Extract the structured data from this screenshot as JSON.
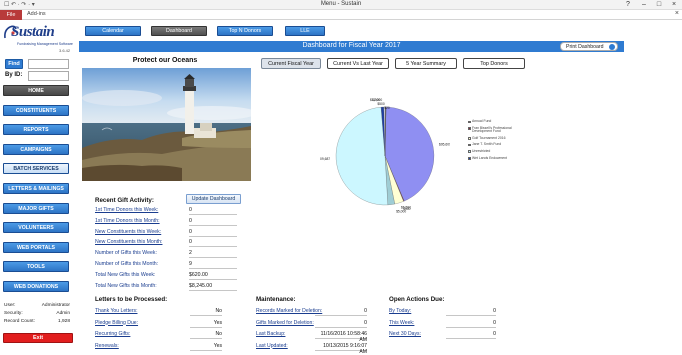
{
  "window": {
    "title": "Menu - Sustain",
    "file_tab": "File",
    "addins_tab": "Add-ins",
    "quick_access": "☐ ↶ · ↷ · ▾"
  },
  "logo": {
    "wordmark": "Sustain",
    "tagline": "Fundraising Management Software",
    "version": "3.6.42"
  },
  "search": {
    "find_label": "Find",
    "by_id_label": "By ID:",
    "find_value": "",
    "id_value": ""
  },
  "nav": [
    {
      "label": "HOME",
      "style": "dark"
    },
    {
      "label": "CONSTITUENTS",
      "style": "blue"
    },
    {
      "label": "REPORTS",
      "style": "blue"
    },
    {
      "label": "CAMPAIGNS",
      "style": "blue"
    },
    {
      "label": "BATCH SERVICES",
      "style": "hover"
    },
    {
      "label": "LETTERS & MAILINGS",
      "style": "blue"
    },
    {
      "label": "MAJOR GIFTS",
      "style": "blue"
    },
    {
      "label": "VOLUNTEERS",
      "style": "blue"
    },
    {
      "label": "WEB PORTALS",
      "style": "blue"
    },
    {
      "label": "TOOLS",
      "style": "blue"
    },
    {
      "label": "WEB DONATIONS",
      "style": "blue"
    }
  ],
  "session": {
    "user_label": "User:",
    "user_value": "Administrator",
    "security_label": "Security:",
    "security_value": "Admin",
    "count_label": "Record Count:",
    "count_value": "1,928"
  },
  "exit_label": "Exit",
  "top_tabs": [
    "Calendar",
    "Dashboard",
    "Top N Donors",
    "LLE"
  ],
  "active_top_tab": "Dashboard",
  "header": {
    "title": "Dashboard for Fiscal Year 2017",
    "print_label": "Print Dashboard"
  },
  "photo": {
    "title": "Protect our Oceans"
  },
  "recent_activity": {
    "title": "Recent Gift Activity:",
    "update_label": "Update Dashboard",
    "rows": [
      {
        "label": "1st Time Donors this Week:",
        "value": "0"
      },
      {
        "label": "1st Time Donors this Month:",
        "value": "0"
      },
      {
        "label": "New Constituents this Week:",
        "value": "0"
      },
      {
        "label": "New Constituents this Month:",
        "value": "0"
      },
      {
        "label": "Number of Gifts this Week:",
        "value": "2"
      },
      {
        "label": "Number of Gifts this Month:",
        "value": "9"
      },
      {
        "label": "Total New Gifts this Week:",
        "value": "$620.00"
      },
      {
        "label": "Total New Gifts this Month:",
        "value": "$8,245.00"
      }
    ]
  },
  "letters": {
    "title": "Letters to be Processed:",
    "rows": [
      {
        "label": "Thank You Letters:",
        "value": "No"
      },
      {
        "label": "Pledge Billing Due:",
        "value": "Yes"
      },
      {
        "label": "Recurring Gifts:",
        "value": "No"
      },
      {
        "label": "Renewals:",
        "value": "Yes"
      }
    ]
  },
  "maintenance": {
    "title": "Maintenance:",
    "rows": [
      {
        "label": "Records Marked for Deletion:",
        "value": "0"
      },
      {
        "label": "Gifts Marked for Deletion:",
        "value": "0"
      },
      {
        "label": "Last Backup:",
        "value": "11/16/2016 10:58:46 AM"
      },
      {
        "label": "Last Updated:",
        "value": "10/13/2015 9:16:07 AM"
      }
    ]
  },
  "open_actions": {
    "title": "Open Actions Due:",
    "rows": [
      {
        "label": "By Today:",
        "value": "0"
      },
      {
        "label": "This Week:",
        "value": "0"
      },
      {
        "label": "Next 30 Days:",
        "value": "0"
      }
    ]
  },
  "chart_tabs": [
    "Current Fiscal Year",
    "Current Vs Last Year",
    "5 Year Summary",
    "Top Donors"
  ],
  "active_chart_tab": "Current Fiscal Year",
  "chart_data": {
    "type": "pie",
    "title": "",
    "slices": [
      {
        "name": "Annual Fund",
        "value": 95609,
        "label": "$95,609",
        "color": "#8f8ff2"
      },
      {
        "name": "Fran Bissell's Professional Development Fund",
        "value": 500,
        "label": "$500",
        "color": "#7a2a3a"
      },
      {
        "name": "Golf Tournament 2016",
        "value": 6590,
        "label": "$6,590",
        "color": "#ffffd4"
      },
      {
        "name": "Jane T. Smith Fund",
        "value": 5000,
        "label": "$5,000",
        "color": "#9fcdd4"
      },
      {
        "name": "Unrestricted",
        "value": 109687,
        "label": "$109,687",
        "color": "#ccf7ff"
      },
      {
        "name": "Wet Lands Endowment",
        "value": 2000,
        "label": "$2,000",
        "color": "#1c3ea3"
      },
      {
        "name": "",
        "value": 1000,
        "label": "$1,000",
        "color": "#d4d4e8"
      },
      {
        "name": "",
        "value": 500,
        "label": "$500",
        "color": "#5a5a5a"
      },
      {
        "name": "",
        "value": 20,
        "label": "$20",
        "color": "#3a7ad4"
      }
    ]
  },
  "legend_entries": [
    {
      "name": "Annual Fund",
      "color": "#8f8ff2"
    },
    {
      "name": "Fran Bissell's Professional Development Fund",
      "color": "#7a2a3a"
    },
    {
      "name": "Golf Tournament 2016",
      "color": "#ffffd4"
    },
    {
      "name": "Jane T. Smith Fund",
      "color": "#9fcdd4"
    },
    {
      "name": "Unrestricted",
      "color": "#ccf7ff"
    },
    {
      "name": "Wet Lands Endowment",
      "color": "#1c3ea3"
    }
  ]
}
